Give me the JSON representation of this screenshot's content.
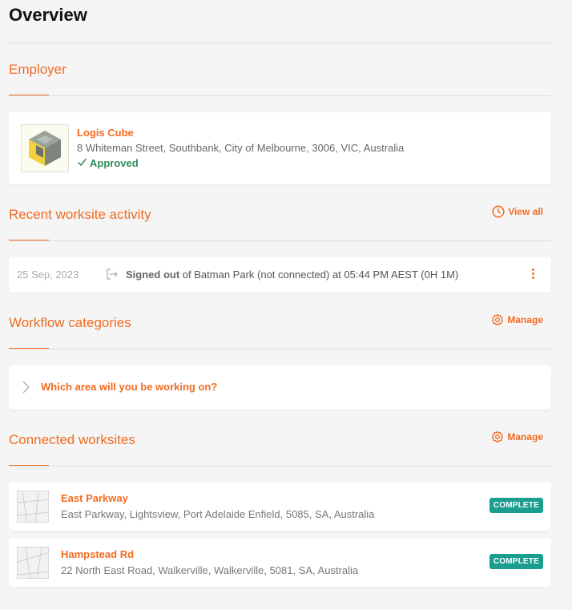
{
  "page": {
    "title": "Overview"
  },
  "employer": {
    "section_title": "Employer",
    "name": "Logis Cube",
    "address": "8 Whiteman Street, Southbank, City of Melbourne, 3006, VIC, Australia",
    "status": "Approved",
    "status_color": "#2e8b57"
  },
  "activity": {
    "section_title": "Recent worksite activity",
    "action_label": "View all",
    "action_icon": "clock-icon",
    "items": [
      {
        "date": "25 Sep, 2023",
        "icon": "sign-out-icon",
        "event": "Signed out",
        "detail": "of Batman Park (not connected) at 05:44 PM AEST (0H 1M)"
      }
    ]
  },
  "workflow": {
    "section_title": "Workflow categories",
    "action_label": "Manage",
    "action_icon": "gear-icon",
    "items": [
      {
        "label": "Which area will you be working on?"
      }
    ]
  },
  "worksites": {
    "section_title": "Connected worksites",
    "action_label": "Manage",
    "action_icon": "gear-icon",
    "items": [
      {
        "name": "East Parkway",
        "address": "East Parkway, Lightsview, Port Adelaide Enfield, 5085, SA, Australia",
        "status": "COMPLETE"
      },
      {
        "name": "Hampstead Rd",
        "address": "22 North East Road, Walkerville, Walkerville, 5081, SA, Australia",
        "status": "COMPLETE"
      }
    ]
  },
  "colors": {
    "accent": "#f26b21",
    "background": "#f5f5f5",
    "complete_badge": "#1a9e8f"
  }
}
